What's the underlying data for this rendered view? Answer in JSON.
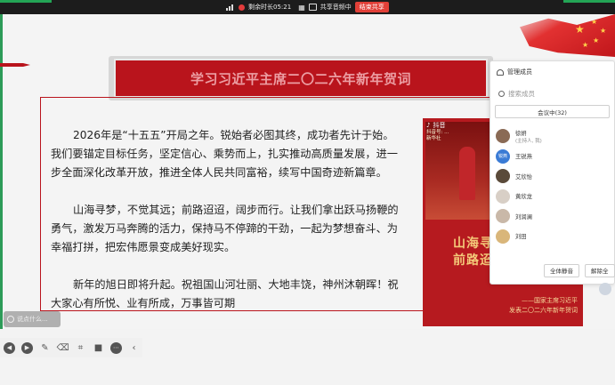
{
  "meeting_bar": {
    "remaining_label": "剩余时长05:21",
    "share_label": "共享音频中",
    "stop_label": "结束共享"
  },
  "slide": {
    "title": "学习习近平主席二〇二六年新年贺词",
    "paragraphs": [
      "2026年是“十五五”开局之年。锐始者必图其终，成功者先计于始。我们要锚定目标任务，坚定信心、乘势而上，扎实推动高质量发展，进一步全面深化改革开放，推进全体人民共同富裕，续写中国奇迹新篇章。",
      "山海寻梦，不觉其远；前路迢迢，阔步而行。让我们拿出跃马扬鞭的勇气，激发万马奔腾的活力，保持马不停蹄的干劲，一起为梦想奋斗、为幸福打拼，把宏伟愿景变成美好现实。",
      "新年的旭日即将升起。祝祖国山河壮丽、大地丰饶，神州沐朝晖！祝大家心有所悦、业有所成，万事皆可期"
    ],
    "poster": {
      "platform": "抖音",
      "account_line1": "抖音号: ...",
      "account_line2": "新华社",
      "slogan_line1": "山海寻",
      "slogan_line2": "前路迢",
      "sign_line1": "——国家主席习近平",
      "sign_line2": "发表二〇二六年新年贺词"
    }
  },
  "members_panel": {
    "title": "管理成员",
    "search_placeholder": "搜索成员",
    "in_meeting_tab": "会议中(32)",
    "members": [
      {
        "name": "徐妍",
        "sub": "(主持人, 我)",
        "color": "#8a6a55"
      },
      {
        "name": "王锐燕",
        "sub": "",
        "color": "#3a7bd5",
        "initials": "锐燕"
      },
      {
        "name": "艾欣怡",
        "sub": "",
        "color": "#5a4a3a"
      },
      {
        "name": "黄欣龙",
        "sub": "",
        "color": "#d8cfc6"
      },
      {
        "name": "刘润澜",
        "sub": "",
        "color": "#c9b8a8"
      },
      {
        "name": "刘田",
        "sub": "",
        "color": "#d9b67a"
      }
    ],
    "mute_all_label": "全体静音",
    "unmute_label": "解除全"
  },
  "bottom": {
    "chat_placeholder": "说点什么..."
  }
}
